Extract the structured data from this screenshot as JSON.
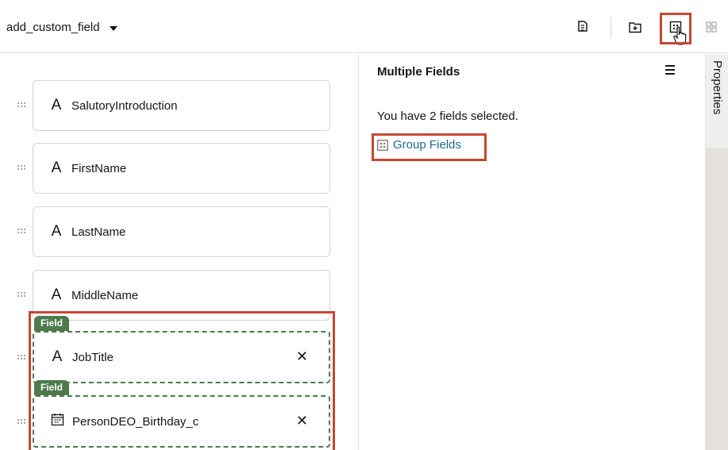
{
  "header": {
    "layout_name": "add_custom_field",
    "icons": [
      "copy-icon",
      "add-section-icon",
      "group-fields-icon",
      "ungroup-icon"
    ]
  },
  "canvas": {
    "fields": [
      {
        "icon": "text-field-icon",
        "label": "SalutoryIntroduction",
        "selected": false
      },
      {
        "icon": "text-field-icon",
        "label": "FirstName",
        "selected": false
      },
      {
        "icon": "text-field-icon",
        "label": "LastName",
        "selected": false
      },
      {
        "icon": "text-field-icon",
        "label": "MiddleName",
        "selected": false
      },
      {
        "icon": "text-field-icon",
        "label": "JobTitle",
        "selected": true,
        "tag": "Field"
      },
      {
        "icon": "calendar-icon",
        "label": "PersonDEO_Birthday_c",
        "selected": true,
        "tag": "Field"
      }
    ],
    "remove_label": "✕"
  },
  "panel": {
    "title": "Multiple Fields",
    "selection_text": "You have 2 fields selected.",
    "group_button": "Group Fields"
  },
  "side_tab": {
    "label": "Properties"
  },
  "colors": {
    "highlight": "#c74634",
    "field_tag": "#4e7a4b",
    "link": "#1e6a8a"
  }
}
